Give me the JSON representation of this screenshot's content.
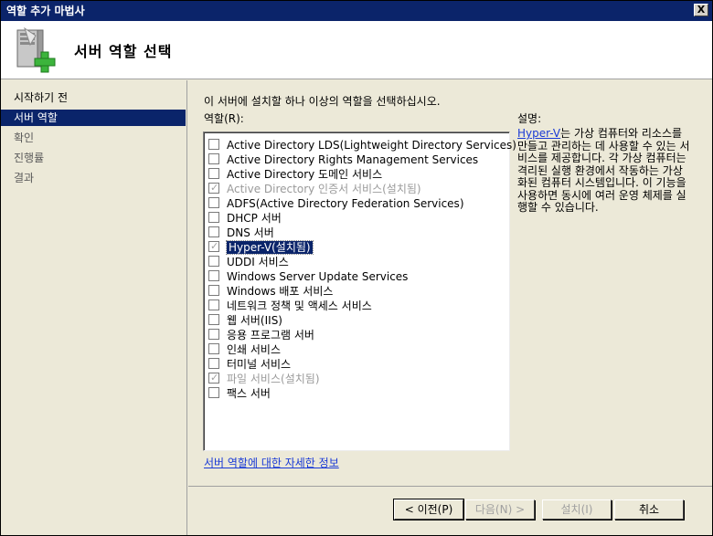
{
  "window": {
    "title": "역할 추가 마법사",
    "close_glyph": "X"
  },
  "header": {
    "title": "서버 역할 선택",
    "icon": "server-add-icon"
  },
  "nav": {
    "items": [
      {
        "label": "시작하기 전",
        "state": "normal"
      },
      {
        "label": "서버 역할",
        "state": "active"
      },
      {
        "label": "확인",
        "state": "normal"
      },
      {
        "label": "진행률",
        "state": "normal"
      },
      {
        "label": "결과",
        "state": "normal"
      }
    ]
  },
  "main": {
    "instruction": "이 서버에 설치할 하나 이상의 역할을 선택하십시오.",
    "roles_label": "역할(R):",
    "description_label": "설명:",
    "roles": [
      {
        "label": "Active Directory LDS(Lightweight Directory Services)",
        "checked": false,
        "disabled": false
      },
      {
        "label": "Active Directory Rights Management Services",
        "checked": false,
        "disabled": false
      },
      {
        "label": "Active Directory 도메인 서비스",
        "checked": false,
        "disabled": false
      },
      {
        "label": "Active Directory 인증서 서비스(설치됨)",
        "checked": true,
        "disabled": true
      },
      {
        "label": "ADFS(Active Directory Federation Services)",
        "checked": false,
        "disabled": false
      },
      {
        "label": "DHCP 서버",
        "checked": false,
        "disabled": false
      },
      {
        "label": "DNS 서버",
        "checked": false,
        "disabled": false
      },
      {
        "label": "Hyper-V(설치됨)",
        "checked": true,
        "disabled": true,
        "selected": true
      },
      {
        "label": "UDDI 서비스",
        "checked": false,
        "disabled": false
      },
      {
        "label": "Windows Server Update Services",
        "checked": false,
        "disabled": false
      },
      {
        "label": "Windows 배포 서비스",
        "checked": false,
        "disabled": false
      },
      {
        "label": "네트워크 정책 및 액세스 서비스",
        "checked": false,
        "disabled": false
      },
      {
        "label": "웹 서버(IIS)",
        "checked": false,
        "disabled": false
      },
      {
        "label": "응용 프로그램 서버",
        "checked": false,
        "disabled": false
      },
      {
        "label": "인쇄 서비스",
        "checked": false,
        "disabled": false
      },
      {
        "label": "터미널 서비스",
        "checked": false,
        "disabled": false
      },
      {
        "label": "파일 서비스(설치됨)",
        "checked": true,
        "disabled": true
      },
      {
        "label": "팩스 서버",
        "checked": false,
        "disabled": false
      }
    ],
    "description": {
      "link": "Hyper-V",
      "text": "는 가상 컴퓨터와 리소스를 만들고 관리하는 데 사용할 수 있는 서비스를 제공합니다. 각 가상 컴퓨터는 격리된 실행 환경에서 작동하는 가상화된 컴퓨터 시스템입니다. 이 기능을 사용하면 동시에 여러 운영 체제를 실행할 수 있습니다."
    },
    "more_info_link": "서버 역할에 대한 자세한 정보"
  },
  "footer": {
    "back": "< 이전(P)",
    "next": "다음(N) >",
    "install": "설치(I)",
    "cancel": "취소"
  },
  "colors": {
    "title_bar": "#0b246a",
    "selection": "#0a246a",
    "link": "#1a3ad6"
  }
}
